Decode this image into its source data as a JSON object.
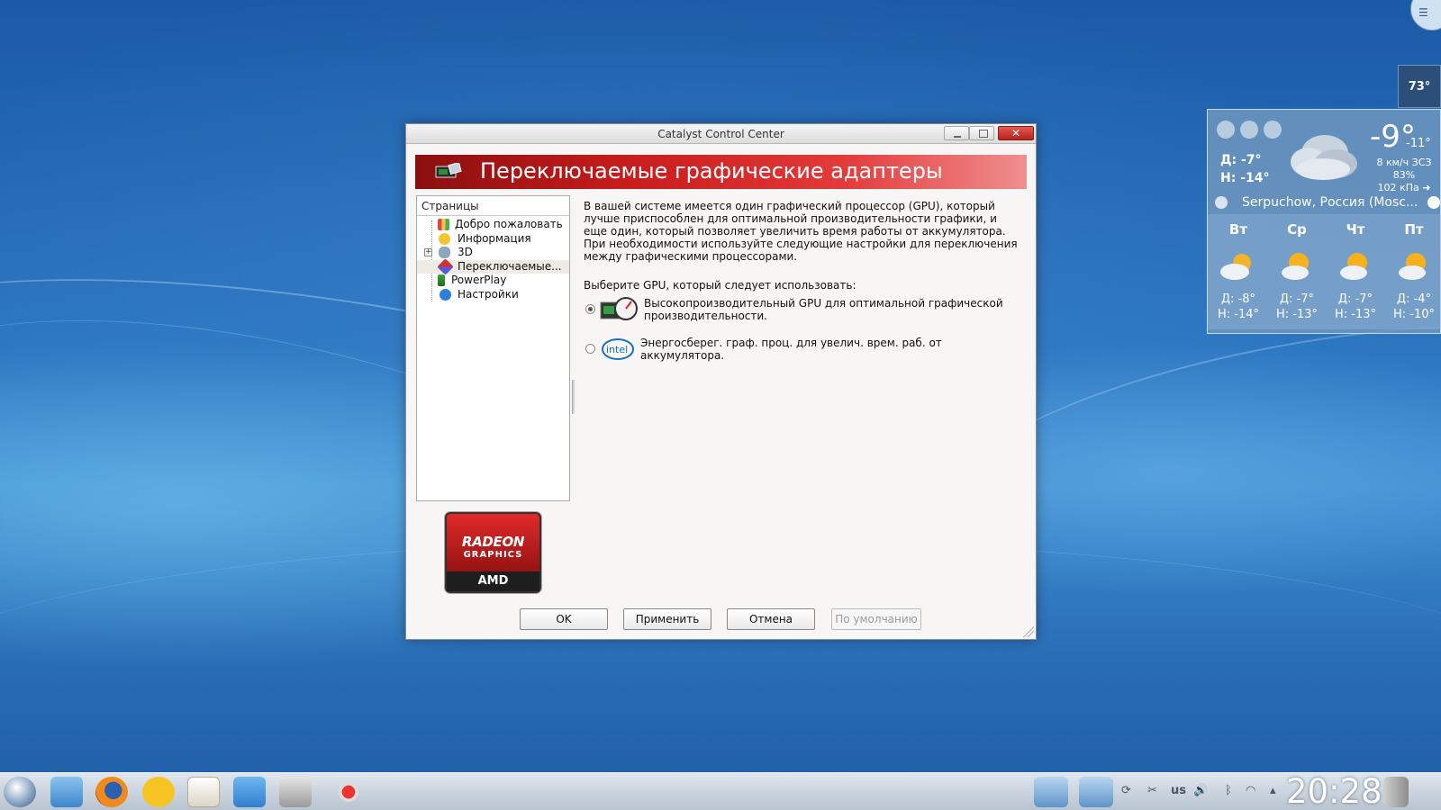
{
  "desktop": {
    "temp_badge": "73°"
  },
  "weather": {
    "today_high": "Д: -7°",
    "today_low": "Н: -14°",
    "current_temp": "-9°",
    "current_low": "-11°",
    "wind": "8 км/ч ЗСЗ",
    "humidity": "83%",
    "pressure": "102 кПа ➜",
    "location": "Serpuchow, Россия (Mosc...",
    "days": [
      {
        "name": "Вт",
        "high": "Д: -8°",
        "low": "Н: -14°"
      },
      {
        "name": "Ср",
        "high": "Д: -7°",
        "low": "Н: -13°"
      },
      {
        "name": "Чт",
        "high": "Д: -7°",
        "low": "Н: -13°"
      },
      {
        "name": "Пт",
        "high": "Д: -4°",
        "low": "Н: -10°"
      }
    ]
  },
  "window": {
    "title": "Catalyst Control Center",
    "banner": "Переключаемые графические адаптеры"
  },
  "tree": {
    "header": "Страницы",
    "items": [
      {
        "label": "Добро пожаловать"
      },
      {
        "label": "Информация"
      },
      {
        "label": "3D"
      },
      {
        "label": "Переключаемые..."
      },
      {
        "label": "PowerPlay"
      },
      {
        "label": "Настройки"
      }
    ]
  },
  "logo": {
    "line1": "RADEON",
    "line2": "GRAPHICS",
    "line3": "AMD"
  },
  "content": {
    "description": "В вашей системе имеется один графический процессор (GPU), который лучше приспособлен для оптимальной производительности графики, и еще один, который позволяет увеличить время работы от аккумулятора. При необходимости используйте следующие настройки для переключения между графическими процессорами.",
    "choose_label": "Выберите GPU, который следует использовать:",
    "options": [
      {
        "label": "Высокопроизводительный GPU для оптимальной графической производительности.",
        "selected": true
      },
      {
        "label": "Энергосберег. граф. проц. для увелич. врем. раб. от аккумулятора.",
        "selected": false
      }
    ],
    "intel_text": "intel"
  },
  "buttons": {
    "ok": "OK",
    "apply": "Применить",
    "cancel": "Отмена",
    "defaults": "По умолчанию"
  },
  "taskbar": {
    "clock": "20:28",
    "keyboard_layout": "us"
  }
}
